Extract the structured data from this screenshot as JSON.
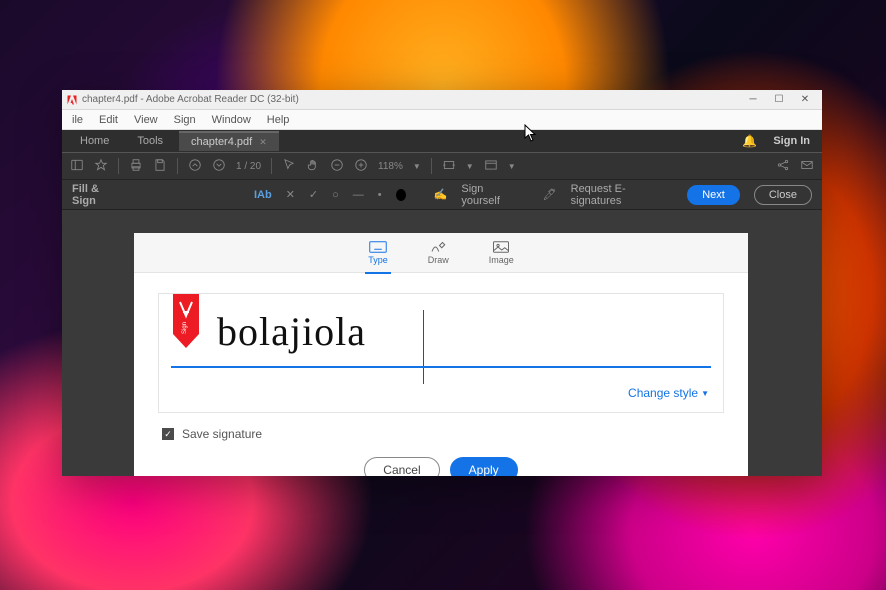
{
  "window": {
    "title": "chapter4.pdf - Adobe Acrobat Reader DC (32-bit)"
  },
  "menu": {
    "items": [
      "ile",
      "Edit",
      "View",
      "Sign",
      "Window",
      "Help"
    ]
  },
  "tabs": {
    "home": "Home",
    "tools": "Tools",
    "doc": "chapter4.pdf",
    "sign_in": "Sign In"
  },
  "toolbar": {
    "page_current": "1",
    "page_total": "20",
    "zoom": "118%"
  },
  "fill_sign": {
    "label": "Fill & Sign",
    "text_tool": "IAb",
    "sign_yourself": "Sign yourself",
    "request": "Request E-signatures",
    "next": "Next",
    "close": "Close"
  },
  "signature_dialog": {
    "tabs": {
      "type": "Type",
      "draw": "Draw",
      "image": "Image"
    },
    "ribbon_label": "Sign",
    "typed_signature": "bolajiola",
    "change_style": "Change style",
    "save_signature": "Save signature",
    "save_signature_checked": true,
    "cancel": "Cancel",
    "apply": "Apply"
  }
}
